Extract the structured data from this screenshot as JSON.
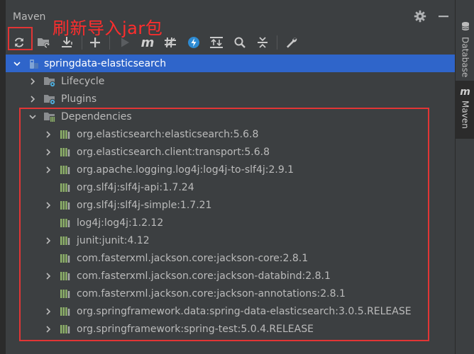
{
  "panel": {
    "title": "Maven",
    "annotation": "刷新导入jar包"
  },
  "colors": {
    "accent_selected": "#2f65ca",
    "annotation_red": "#ff2d2d",
    "library_icon": "#8fb36a",
    "folder_icon": "#8a8d90",
    "gear_badge": "#4eaad8"
  },
  "toolbar": [
    {
      "name": "reload-all-maven-projects-button",
      "icon": "refresh-icon"
    },
    {
      "name": "generate-sources-button",
      "icon": "folder-refresh-icon"
    },
    {
      "name": "download-sources-button",
      "icon": "download-icon"
    },
    {
      "name": "add-maven-project-button",
      "icon": "plus-icon"
    },
    {
      "name": "run-maven-build-button",
      "icon": "run-icon"
    },
    {
      "name": "execute-maven-goal-button",
      "icon": "m-icon"
    },
    {
      "name": "toggle-offline-mode-button",
      "icon": "offline-icon"
    },
    {
      "name": "skip-tests-button",
      "icon": "skip-tests-icon"
    },
    {
      "name": "show-dependencies-button",
      "icon": "diagram-icon"
    },
    {
      "name": "find-button",
      "icon": "search-icon"
    },
    {
      "name": "collapse-all-button",
      "icon": "collapse-icon"
    },
    {
      "name": "maven-settings-button",
      "icon": "wrench-icon"
    }
  ],
  "tree": {
    "project": "springdata-elasticsearch",
    "lifecycle": "Lifecycle",
    "plugins": "Plugins",
    "dependencies_label": "Dependencies",
    "dependencies": [
      {
        "label": "org.elasticsearch:elasticsearch:5.6.8",
        "expandable": true
      },
      {
        "label": "org.elasticsearch.client:transport:5.6.8",
        "expandable": true
      },
      {
        "label": "org.apache.logging.log4j:log4j-to-slf4j:2.9.1",
        "expandable": true
      },
      {
        "label": "org.slf4j:slf4j-api:1.7.24",
        "expandable": false
      },
      {
        "label": "org.slf4j:slf4j-simple:1.7.21",
        "expandable": true
      },
      {
        "label": "log4j:log4j:1.2.12",
        "expandable": false
      },
      {
        "label": "junit:junit:4.12",
        "expandable": true
      },
      {
        "label": "com.fasterxml.jackson.core:jackson-core:2.8.1",
        "expandable": false
      },
      {
        "label": "com.fasterxml.jackson.core:jackson-databind:2.8.1",
        "expandable": true
      },
      {
        "label": "com.fasterxml.jackson.core:jackson-annotations:2.8.1",
        "expandable": false
      },
      {
        "label": "org.springframework.data:spring-data-elasticsearch:3.0.5.RELEASE",
        "expandable": true
      },
      {
        "label": "org.springframework:spring-test:5.0.4.RELEASE",
        "expandable": true
      }
    ]
  },
  "side_tabs": {
    "database": "Database",
    "maven": "Maven"
  }
}
